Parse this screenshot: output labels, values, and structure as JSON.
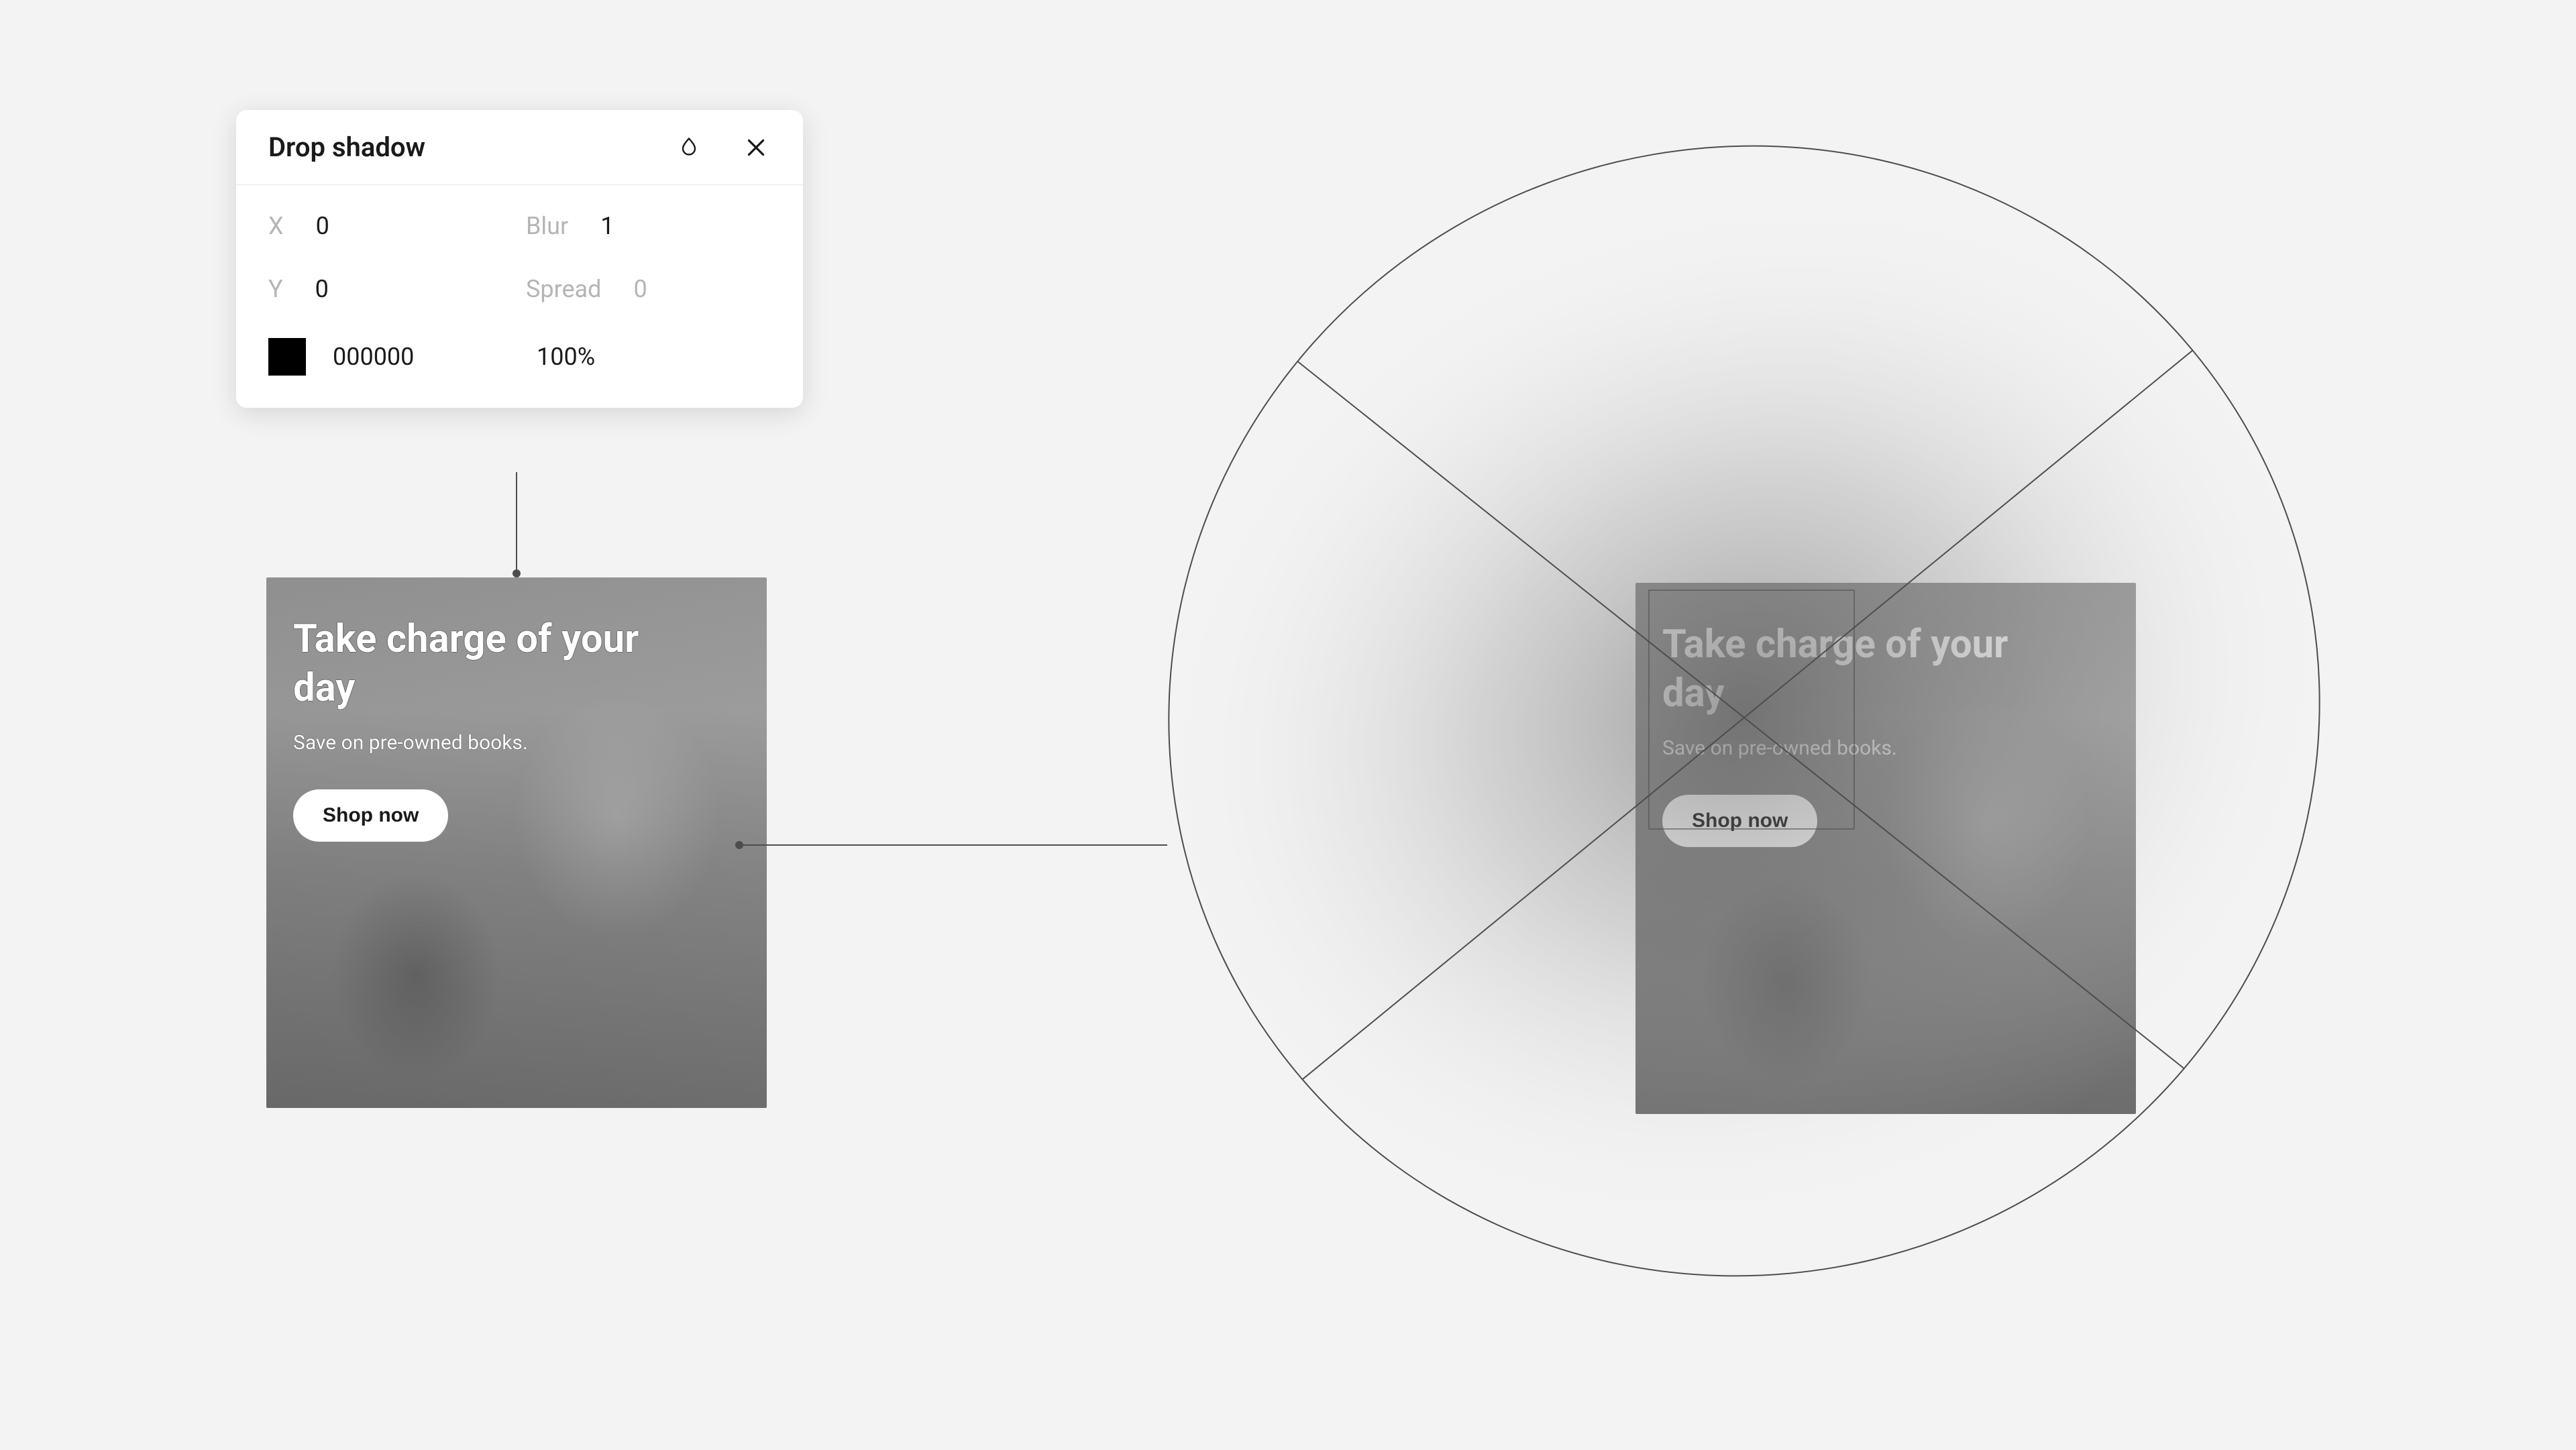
{
  "panel": {
    "title": "Drop shadow",
    "fields": {
      "x": {
        "label": "X",
        "value": "0"
      },
      "y": {
        "label": "Y",
        "value": "0"
      },
      "blur": {
        "label": "Blur",
        "value": "1"
      },
      "spread": {
        "label": "Spread",
        "value": "0"
      }
    },
    "color": {
      "hex": "000000",
      "opacity": "100%"
    },
    "icons": {
      "blend": "blend-mode-icon",
      "close": "close-icon"
    }
  },
  "card": {
    "title": "Take charge of your day",
    "sub": "Save on pre-owned books.",
    "button": "Shop now"
  }
}
